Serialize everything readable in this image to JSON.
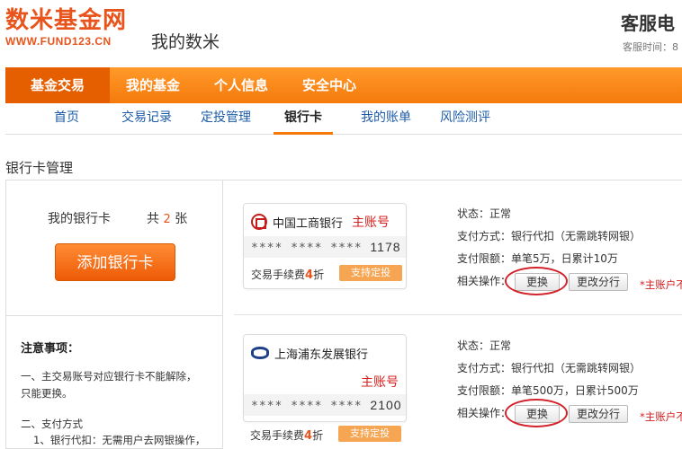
{
  "header": {
    "logo_text": "数米基金网",
    "logo_url": "WWW.FUND123.CN",
    "site_subtitle": "我的数米",
    "service_title": "客服电",
    "service_sub": "客服时间：8"
  },
  "main_nav": [
    {
      "label": "基金交易",
      "active": true
    },
    {
      "label": "我的基金",
      "active": false
    },
    {
      "label": "个人信息",
      "active": false
    },
    {
      "label": "安全中心",
      "active": false
    }
  ],
  "sub_nav": [
    {
      "label": "首页",
      "active": false
    },
    {
      "label": "交易记录",
      "active": false
    },
    {
      "label": "定投管理",
      "active": false
    },
    {
      "label": "银行卡",
      "active": true
    },
    {
      "label": "我的账单",
      "active": false
    },
    {
      "label": "风险测评",
      "active": false
    }
  ],
  "section_title": "银行卡管理",
  "left_panel": {
    "my_cards_label": "我的银行卡",
    "count_prefix": "共",
    "count": "2",
    "count_suffix": "张",
    "add_button": "添加银行卡",
    "notes_title": "注意事项：",
    "notes": [
      "一、主交易账号对应银行卡不能解除，",
      "只能更换。",
      "二、支付方式",
      "1、银行代扣：无需用户去网银操作，"
    ]
  },
  "cards": [
    {
      "bank_name": "中国工商银行",
      "bank_icon": "icbc-logo-icon",
      "master_label": "主账号",
      "masked_number": "**** **** ****",
      "last_digits": "1178",
      "fee_prefix": "交易手续费",
      "fee_value": "4",
      "fee_suffix": "折",
      "sip_button": "支持定投",
      "status": "状态：正常",
      "payment": "支付方式：银行代扣（无需跳转网银）",
      "limit": "支付限额：单笔5万，日累计10万",
      "ops_label": "相关操作：",
      "change_button": "更换",
      "change_branch_button": "更改分行",
      "master_note": "*主账户不"
    },
    {
      "bank_name": "上海浦东发展银行",
      "bank_icon": "spdb-logo-icon",
      "master_label": "主账号",
      "masked_number": "**** **** ****",
      "last_digits": "2100",
      "fee_prefix": "交易手续费",
      "fee_value": "4",
      "fee_suffix": "折",
      "sip_button": "支持定投",
      "status": "状态：正常",
      "payment": "支付方式：银行代扣（无需跳转网银）",
      "limit": "支付限额：单笔500万，日累计500万",
      "ops_label": "相关操作：",
      "change_button": "更换",
      "change_branch_button": "更改分行",
      "master_note": "*主账户不"
    }
  ],
  "colors": {
    "brand_orange": "#f57a0c",
    "nav_active": "#e55f00",
    "link_blue": "#1e5ca8",
    "alert_red": "#d42020"
  }
}
